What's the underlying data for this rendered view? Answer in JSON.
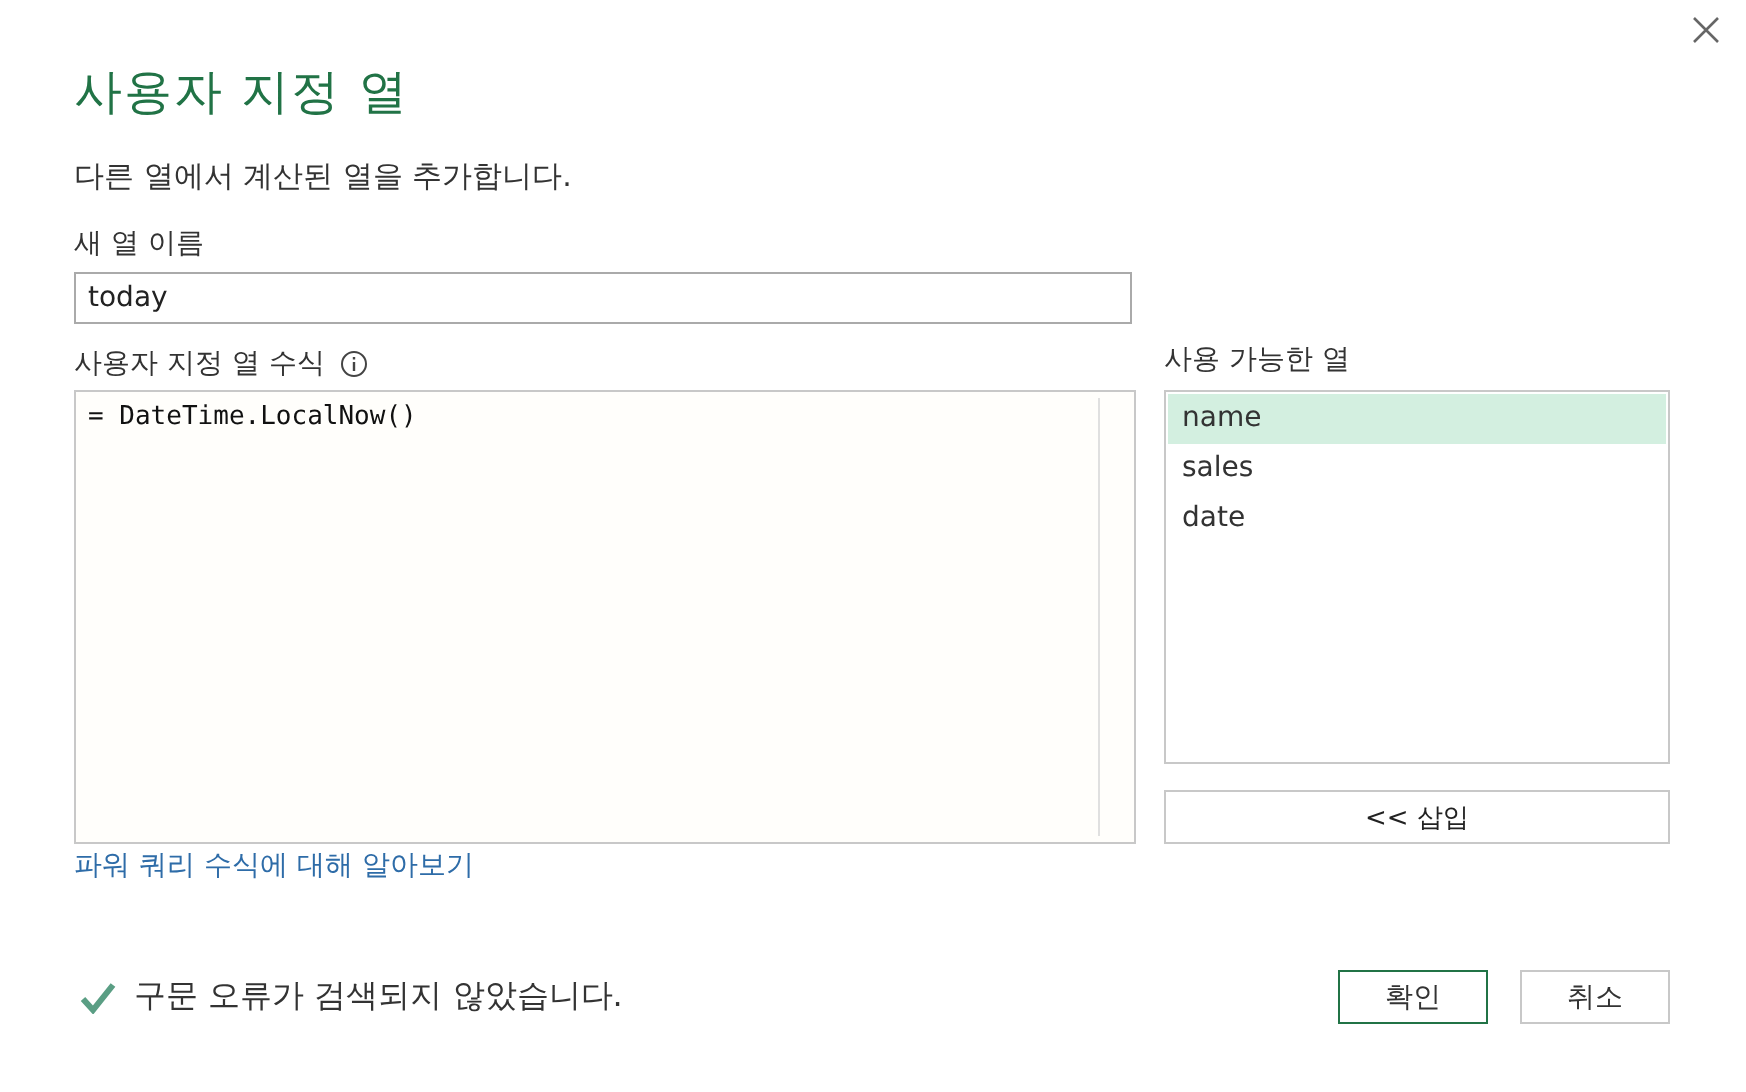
{
  "dialog": {
    "title": "사용자 지정 열",
    "description": "다른 열에서 계산된 열을 추가합니다."
  },
  "new_column_name": {
    "label": "새 열 이름",
    "value": "today"
  },
  "formula": {
    "label": "사용자 지정 열 수식",
    "value": "= DateTime.LocalNow()"
  },
  "available_columns": {
    "label": "사용 가능한 열",
    "items": [
      {
        "label": "name",
        "selected": true
      },
      {
        "label": "sales",
        "selected": false
      },
      {
        "label": "date",
        "selected": false
      }
    ],
    "insert_button": "<< 삽입"
  },
  "learn_link": "파워 쿼리 수식에 대해 알아보기",
  "status": {
    "ok": true,
    "message": "구문 오류가 검색되지 않았습니다."
  },
  "buttons": [
    {
      "label": "확인",
      "kind": "primary"
    },
    {
      "label": "취소",
      "kind": "secondary"
    }
  ]
}
